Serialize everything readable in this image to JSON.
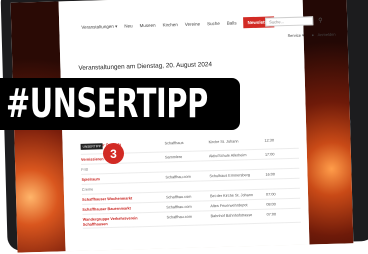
{
  "nav": {
    "items": [
      "Veranstaltungen ▾",
      "Neu",
      "Museen",
      "Kirchen",
      "Vereine",
      "Suche",
      "Balls"
    ],
    "highlight": "Newsletter"
  },
  "search": {
    "placeholder": "Suche..."
  },
  "util": {
    "service": "Service ▾",
    "login": "Anmelden"
  },
  "heading": "Veranstaltungen am Dienstag, 20. August 2024",
  "badge": {
    "text": "#UNSERTIPP",
    "number": "3",
    "tag": "UNSERTIPP"
  },
  "events": {
    "row1": {
      "title": "Schaffhauser Orgelpla",
      "org": "Schaffhaus",
      "place": "Kirche St. Johann",
      "time": "12:30"
    },
    "row2": {
      "title": "Vernissieren",
      "org": "Sammlere",
      "place": "Aktiv/Schule Allerheim",
      "time": "17:00"
    },
    "group1": "Fritt",
    "row3": {
      "title": "Spielraum",
      "org": "Schaffhau.com",
      "place": "Schulhaus Emmersberg",
      "time": "16:00"
    },
    "group2": "Creme",
    "row4": {
      "title": "Schaffhauser Wochenmarkt",
      "org": "Schaffhau.com",
      "place": "Bei der Kirche St. Johann",
      "time": "07:00"
    },
    "row5": {
      "title": "Schaffhauser Bauernmarkt",
      "org": "Schaffhau.com",
      "place": "Altes Feuerwehrdepot",
      "time": "08:00"
    },
    "row6": {
      "title": "Wandergruppe Verkehrsverein Schaffhausen",
      "org": "Schaffhau.com",
      "place": "Bahnhof Bahnhofstrasse",
      "time": "07:00"
    }
  }
}
